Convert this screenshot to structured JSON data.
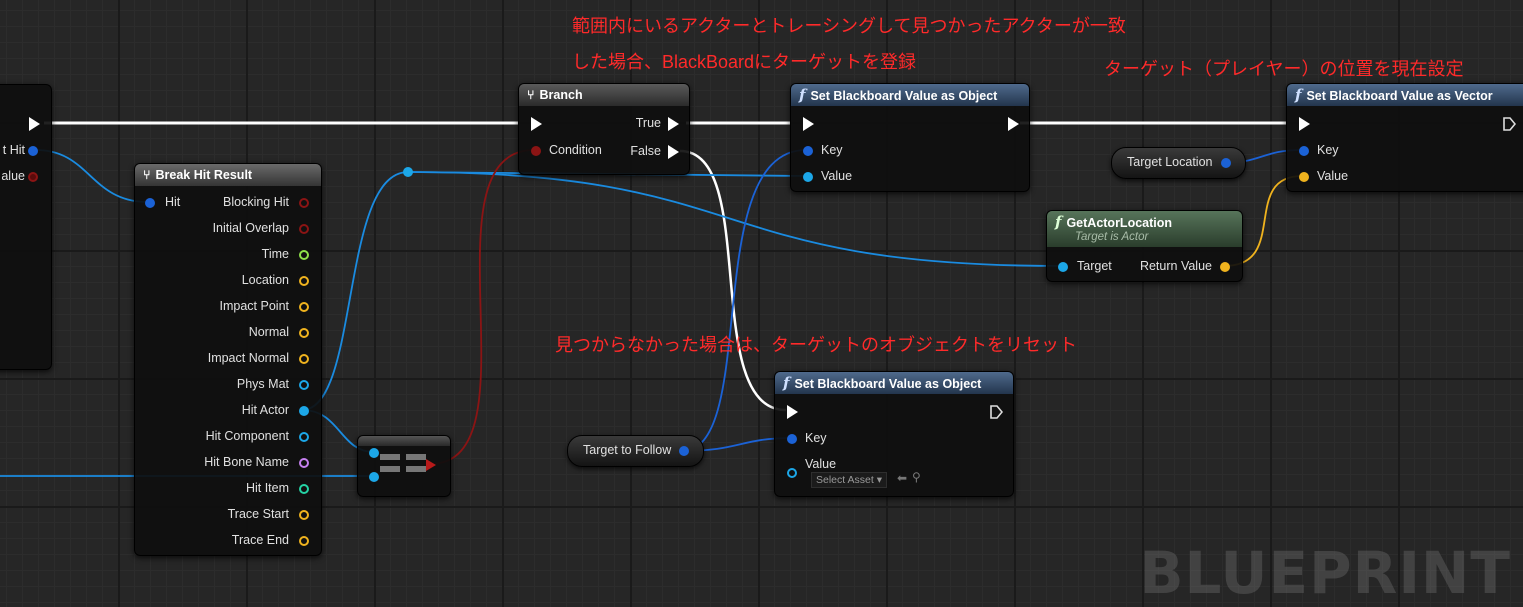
{
  "annotations": {
    "line1": "範囲内にいるアクターとトレーシングして見つかったアクターが一致",
    "line2": "した場合、BlackBoardにターゲットを登録",
    "line3": "ターゲット（プレイヤー）の位置を現在設定",
    "line4": "見つからなかった場合は、ターゲットのオブジェクトをリセット"
  },
  "left_node": {
    "pin1": "t Hit",
    "pin2": "alue"
  },
  "break_hit": {
    "title": "Break Hit Result",
    "input": "Hit",
    "outputs": [
      {
        "label": "Blocking Hit",
        "color": "#8b1414"
      },
      {
        "label": "Initial Overlap",
        "color": "#8b1414"
      },
      {
        "label": "Time",
        "color": "#8fe04a"
      },
      {
        "label": "Location",
        "color": "#f0b31e"
      },
      {
        "label": "Impact Point",
        "color": "#f0b31e"
      },
      {
        "label": "Normal",
        "color": "#f0b31e"
      },
      {
        "label": "Impact Normal",
        "color": "#f0b31e"
      },
      {
        "label": "Phys Mat",
        "color": "#1ca7e8"
      },
      {
        "label": "Hit Actor",
        "color": "#1ca7e8"
      },
      {
        "label": "Hit Component",
        "color": "#1ca7e8"
      },
      {
        "label": "Hit Bone Name",
        "color": "#c680f0"
      },
      {
        "label": "Hit Item",
        "color": "#25d3a5"
      },
      {
        "label": "Trace Start",
        "color": "#f0b31e"
      },
      {
        "label": "Trace End",
        "color": "#f0b31e"
      }
    ]
  },
  "branch": {
    "title": "Branch",
    "condition": "Condition",
    "true_label": "True",
    "false_label": "False"
  },
  "sbvo1": {
    "title": "Set Blackboard Value as Object",
    "key": "Key",
    "value": "Value"
  },
  "sbvv": {
    "title": "Set Blackboard Value as Vector",
    "key": "Key",
    "value": "Value"
  },
  "target_location": {
    "label": "Target Location"
  },
  "get_actor_location": {
    "title": "GetActorLocation",
    "subtitle": "Target is Actor",
    "target": "Target",
    "return_value": "Return Value"
  },
  "sbvo2": {
    "title": "Set Blackboard Value as Object",
    "key": "Key",
    "value": "Value",
    "select_asset": "Select Asset"
  },
  "target_to_follow": {
    "label": "Target to Follow"
  },
  "watermark": "BLUEPRINT",
  "colors": {
    "exec": "#ffffff",
    "object": "#1ca7e8",
    "key": "#1b62d6",
    "bool": "#8b1414",
    "vector": "#f0b31e",
    "annotation": "#ff2a2a"
  }
}
